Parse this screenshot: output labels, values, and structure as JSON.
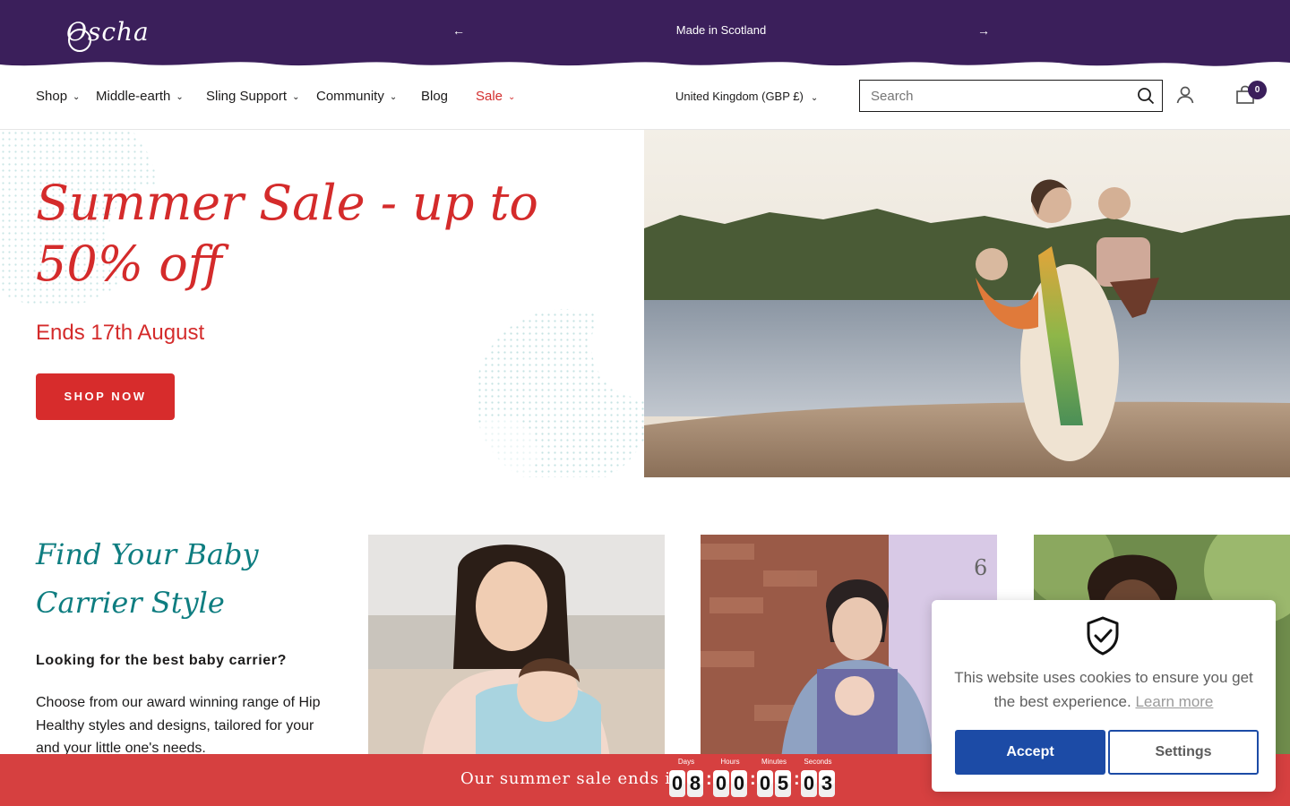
{
  "announcement": {
    "logo": "Oscha",
    "prev_arrow": "←",
    "next_arrow": "→",
    "text": "Made in Scotland"
  },
  "nav": {
    "items": [
      {
        "label": "Shop"
      },
      {
        "label": "Middle-earth"
      },
      {
        "label": "Sling Support"
      },
      {
        "label": "Community"
      },
      {
        "label": "Blog"
      },
      {
        "label": "Sale"
      }
    ],
    "chevron": "⌄",
    "country": "United Kingdom (GBP £)",
    "search_placeholder": "Search",
    "cart_count": "0"
  },
  "hero": {
    "title": "Summer Sale - up to 50% off",
    "subtitle": "Ends 17th August",
    "cta": "SHOP NOW"
  },
  "find": {
    "title": "Find Your Baby Carrier Style",
    "question": "Looking for the best baby carrier?",
    "body": "Choose from our award winning range of Hip Healthy styles and designs, tailored for your and your little one's needs."
  },
  "countdown": {
    "label": "Our summer sale ends in",
    "units": [
      {
        "label": "Days",
        "digits": [
          "0",
          "8"
        ]
      },
      {
        "label": "Hours",
        "digits": [
          "0",
          "0"
        ]
      },
      {
        "label": "Minutes",
        "digits": [
          "0",
          "5"
        ]
      },
      {
        "label": "Seconds",
        "digits": [
          "0",
          "3"
        ]
      }
    ]
  },
  "cookie": {
    "text": "This website uses cookies to ensure you get the best experience.",
    "link": "Learn more",
    "accept": "Accept",
    "settings": "Settings"
  },
  "colors": {
    "brand_purple": "#3b1f5b",
    "sale_red": "#d42b2b",
    "teal": "#0e7d80",
    "accept_blue": "#1c4ba6"
  }
}
